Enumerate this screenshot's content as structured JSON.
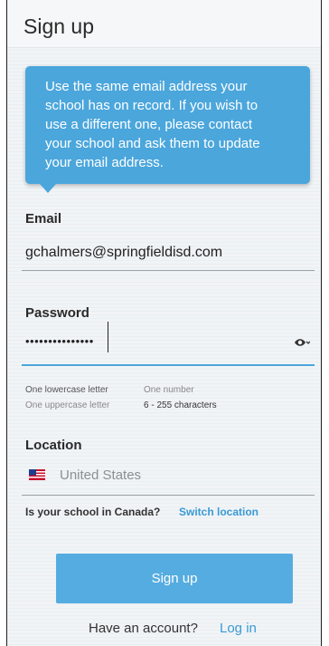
{
  "header": {
    "title": "Sign up"
  },
  "tooltip": {
    "lines": [
      "Use the same email address your",
      "school has on record. If you wish to",
      "use a different one, please contact",
      "your school and ask them to update",
      "your email address."
    ]
  },
  "email": {
    "label": "Email",
    "value": "gchalmers@springfieldisd.com"
  },
  "password": {
    "label": "Password",
    "masked_value": "•••••••••••••••"
  },
  "requirements": {
    "lowercase": "One lowercase letter",
    "number": "One number",
    "uppercase": "One uppercase letter",
    "length": "6 - 255 characters"
  },
  "location": {
    "label": "Location",
    "value": "United States",
    "flag_icon": "us-flag-icon"
  },
  "canada": {
    "question": "Is your school in Canada?",
    "link": "Switch location"
  },
  "actions": {
    "signup_label": "Sign up",
    "have_account": "Have an account?",
    "login_label": "Log in"
  },
  "colors": {
    "accent": "#4ba6dc",
    "button": "#55ace0",
    "link": "#3a9ad6"
  }
}
